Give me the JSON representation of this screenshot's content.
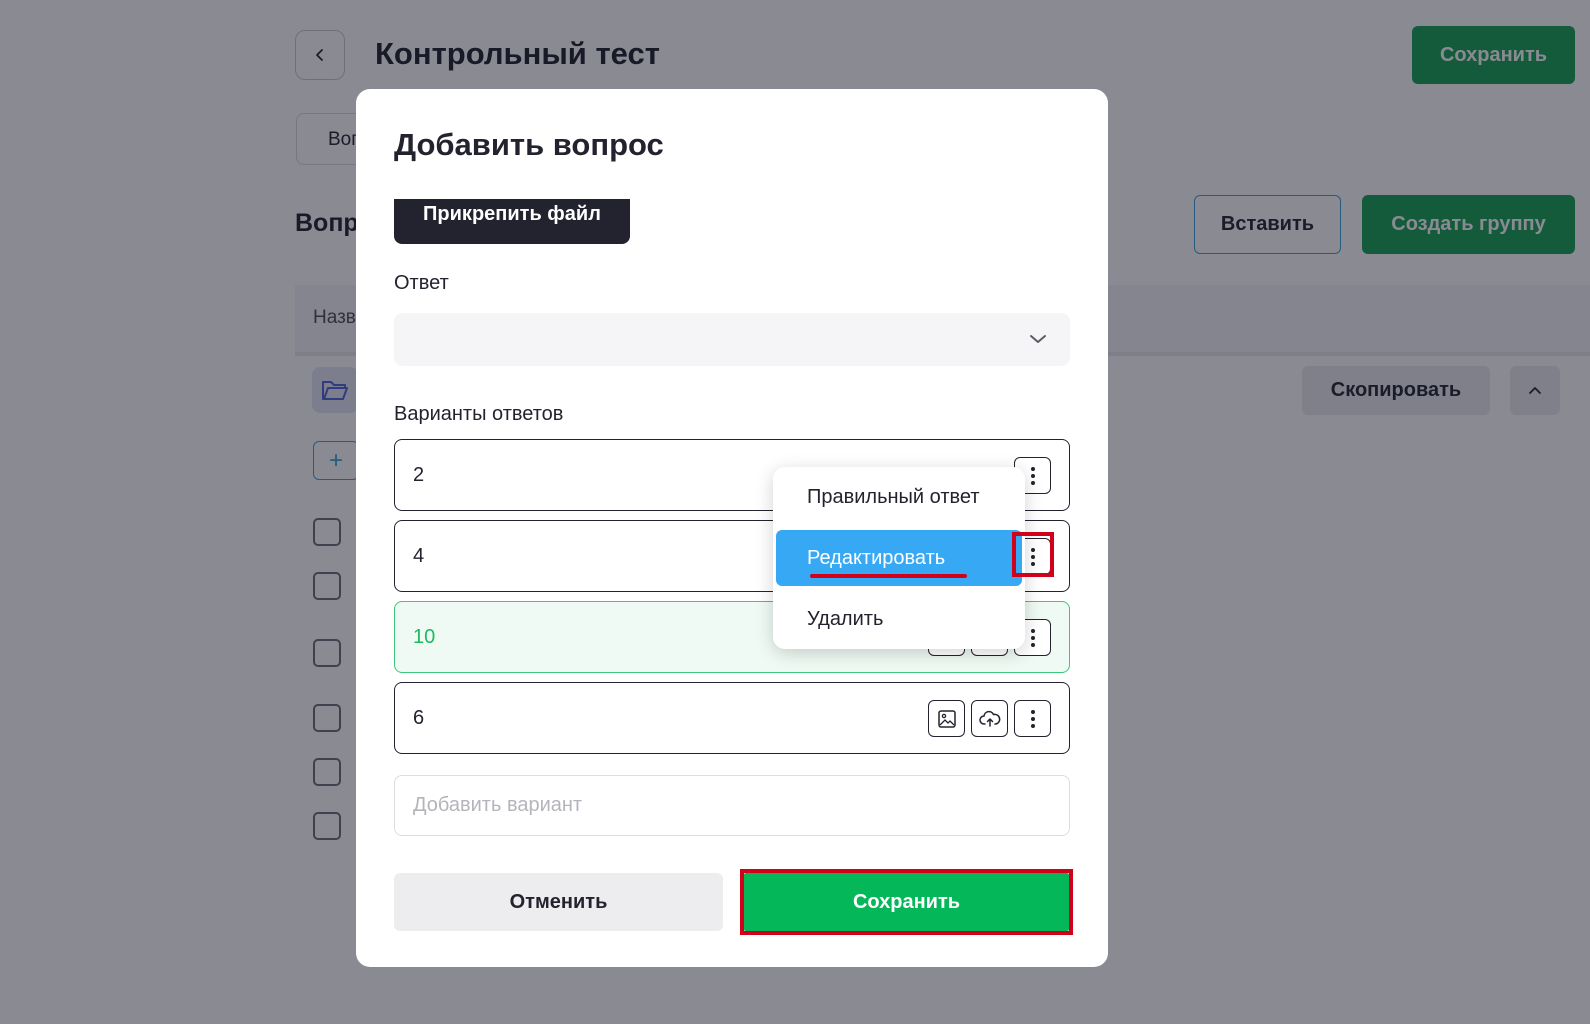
{
  "page": {
    "title": "Контрольный тест",
    "save_label": "Сохранить",
    "tab_label": "Вопросы",
    "section_title": "Вопросы",
    "insert_label": "Вставить",
    "create_group_label": "Создать группу",
    "table_header_name": "Название",
    "copy_label": "Скопировать",
    "add_symbol": "+"
  },
  "modal": {
    "title": "Добавить вопрос",
    "attach_label": "Прикрепить файл",
    "answer_label": "Ответ",
    "answer_value": "",
    "options_label": "Варианты ответов",
    "options": [
      {
        "value": "2",
        "correct": false
      },
      {
        "value": "4",
        "correct": false
      },
      {
        "value": "10",
        "correct": true
      },
      {
        "value": "6",
        "correct": false
      }
    ],
    "add_option_placeholder": "Добавить вариант",
    "cancel_label": "Отменить",
    "save_label": "Сохранить"
  },
  "menu": {
    "items": [
      {
        "label": "Правильный ответ"
      },
      {
        "label": "Редактировать",
        "active": true
      },
      {
        "label": "Удалить"
      }
    ]
  },
  "colors": {
    "accent_green": "#04b85a",
    "menu_active": "#37a9f4",
    "highlight_red": "#d0021b"
  }
}
